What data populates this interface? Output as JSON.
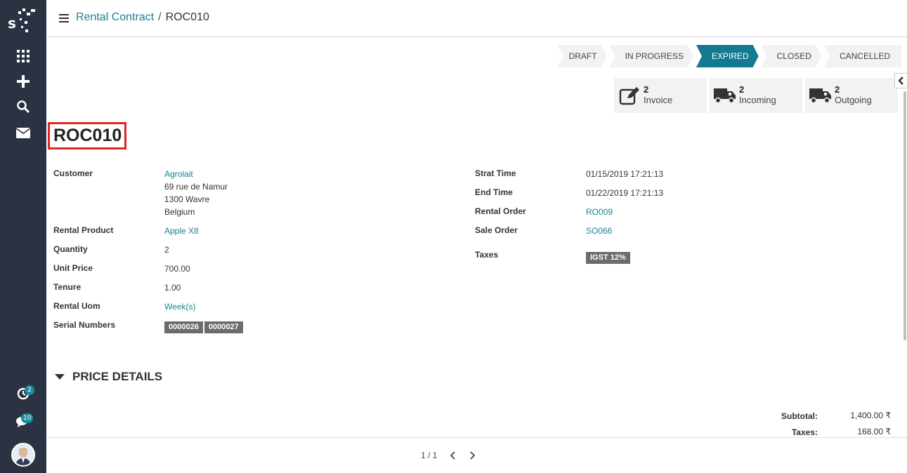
{
  "breadcrumb": {
    "parent": "Rental Contract",
    "separator": "/",
    "current": "ROC010"
  },
  "sidebar": {
    "activity_badge": "2",
    "messages_badge": "10"
  },
  "statusbar": {
    "stages": [
      "DRAFT",
      "IN PROGRESS",
      "EXPIRED",
      "CLOSED",
      "CANCELLED"
    ],
    "active": "EXPIRED"
  },
  "smart_buttons": [
    {
      "count": "2",
      "label": "Invoice",
      "icon": "edit-icon"
    },
    {
      "count": "2",
      "label": "Incoming",
      "icon": "truck-icon"
    },
    {
      "count": "2",
      "label": "Outgoing",
      "icon": "truck-icon"
    }
  ],
  "record": {
    "title": "ROC010",
    "left": {
      "customer_label": "Customer",
      "customer_name": "Agrolait",
      "customer_addr1": "69 rue de Namur",
      "customer_addr2": "1300 Wavre",
      "customer_addr3": "Belgium",
      "product_label": "Rental Product",
      "product_value": "Apple X8",
      "quantity_label": "Quantity",
      "quantity_value": "2",
      "unit_price_label": "Unit Price",
      "unit_price_value": "700.00",
      "tenure_label": "Tenure",
      "tenure_value": "1.00",
      "uom_label": "Rental Uom",
      "uom_value": "Week(s)",
      "serial_label": "Serial Numbers",
      "serials": [
        "0000026",
        "0000027"
      ]
    },
    "right": {
      "start_label": "Strat Time",
      "start_value": "01/15/2019 17:21:13",
      "end_label": "End Time",
      "end_value": "01/22/2019 17:21:13",
      "rental_order_label": "Rental Order",
      "rental_order_value": "RO009",
      "sale_order_label": "Sale Order",
      "sale_order_value": "SO066",
      "taxes_label": "Taxes",
      "taxes_tag": "IGST 12%"
    }
  },
  "price_details": {
    "heading": "PRICE DETAILS",
    "subtotal_label": "Subtotal:",
    "subtotal_value": "1,400.00 ₹",
    "taxes_label": "Taxes:",
    "taxes_value": "168.00 ₹"
  },
  "pager": {
    "text": "1 / 1"
  },
  "colors": {
    "sidebar": "#2b3343",
    "accent": "#137a8f",
    "link": "#1a7f95",
    "highlight": "#e0261f"
  }
}
